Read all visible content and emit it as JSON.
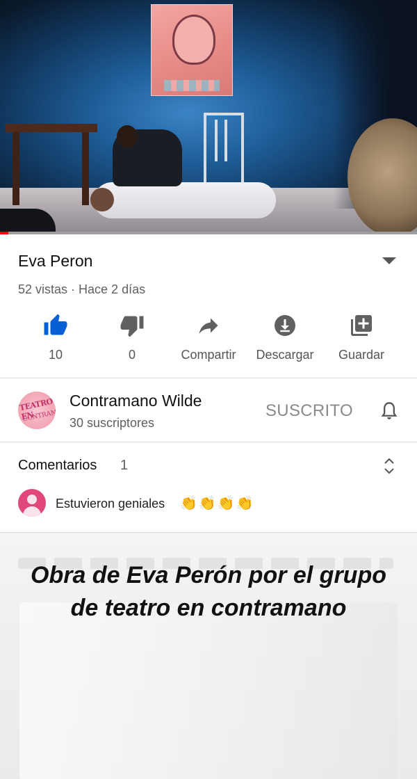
{
  "video": {
    "progress_fraction": 0.02
  },
  "title": "Eva Peron",
  "meta": "52 vistas · Hace 2 días",
  "actions": [
    {
      "icon": "thumbs-up-icon",
      "label": "10",
      "color": "#065fd4"
    },
    {
      "icon": "thumbs-down-icon",
      "label": "0",
      "color": "#606060"
    },
    {
      "icon": "share-icon",
      "label": "Compartir",
      "color": "#606060"
    },
    {
      "icon": "download-icon",
      "label": "Descargar",
      "color": "#606060"
    },
    {
      "icon": "save-playlist-icon",
      "label": "Guardar",
      "color": "#606060"
    }
  ],
  "channel": {
    "logo_text": "TEATRO EN",
    "logo_sub": "CONTRAMANO",
    "name": "Contramano Wilde",
    "subscribers": "30 suscriptores",
    "subscribe_label": "SUSCRITO"
  },
  "comments": {
    "label": "Comentarios",
    "count": "1",
    "top_comment": "Estuvieron geniales",
    "emoji": "👏👏👏👏"
  },
  "story_caption": "Obra de Eva Perón por el grupo de teatro en contramano"
}
